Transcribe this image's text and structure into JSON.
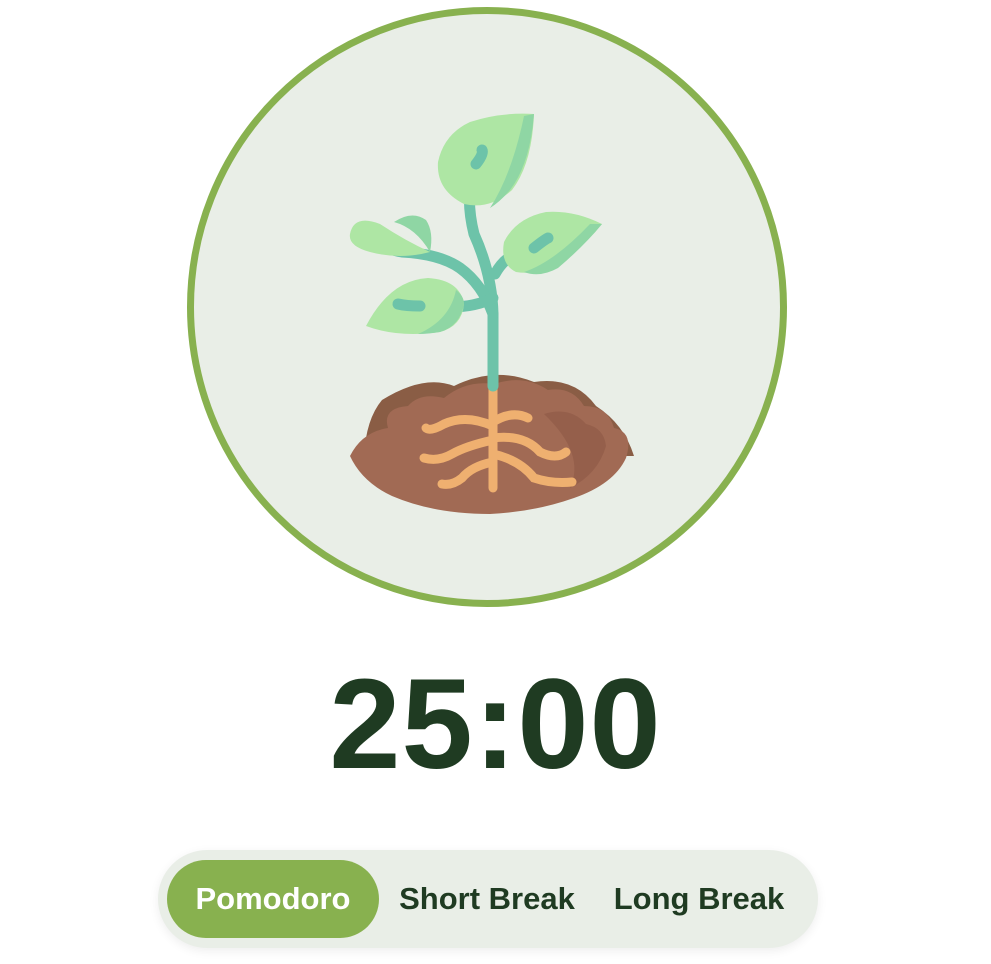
{
  "plant": {
    "icon": "sprout-in-soil-icon",
    "circle_border_color": "#88b14f",
    "circle_fill_color": "#e9eee7"
  },
  "timer": {
    "display": "25:00",
    "color": "#1f3b22"
  },
  "modes": {
    "active": "Pomodoro",
    "accent_color": "#88b14f",
    "items": [
      {
        "label": "Pomodoro"
      },
      {
        "label": "Short Break"
      },
      {
        "label": "Long Break"
      }
    ]
  }
}
